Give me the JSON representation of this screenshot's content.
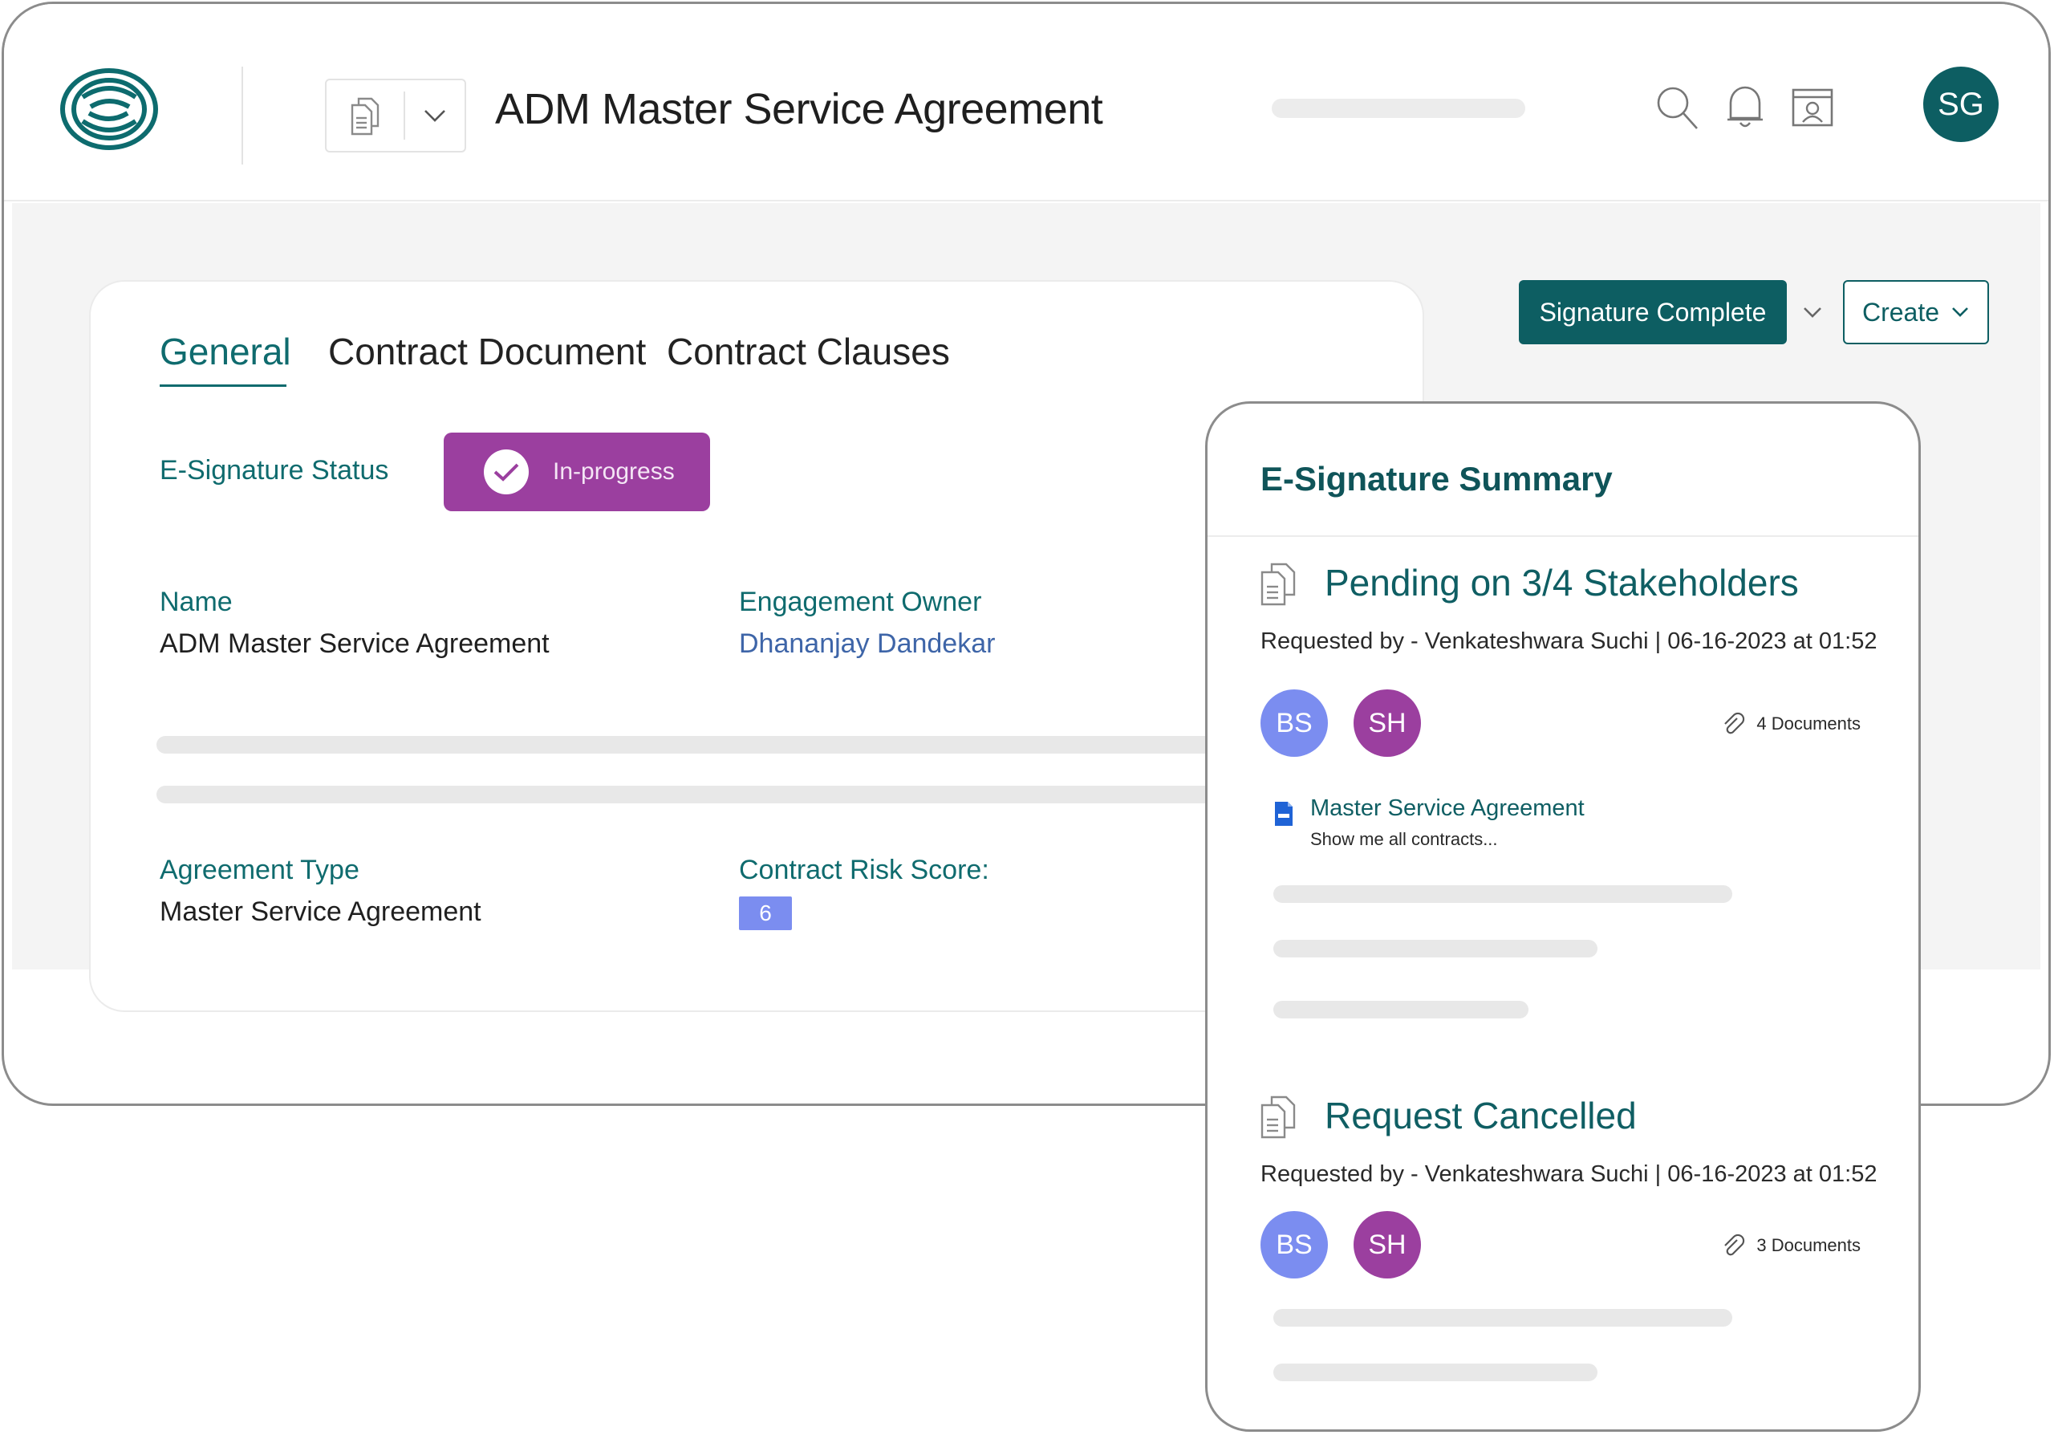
{
  "header": {
    "title": "ADM Master Service Agreement",
    "user_initials": "SG"
  },
  "tabs": [
    {
      "label": "General",
      "active": true
    },
    {
      "label": "Contract Document",
      "active": false
    },
    {
      "label": "Contract Clauses",
      "active": false
    }
  ],
  "general": {
    "esignature_label": "E-Signature Status",
    "esignature_status": "In-progress",
    "name_label": "Name",
    "name_value": "ADM Master Service Agreement",
    "owner_label": "Engagement Owner",
    "owner_value": "Dhananjay Dandekar",
    "agreement_type_label": "Agreement Type",
    "agreement_type_value": "Master Service Agreement",
    "risk_label": "Contract Risk Score:",
    "risk_value": "6"
  },
  "actions": {
    "signature_complete": "Signature Complete",
    "create": "Create"
  },
  "summary": {
    "title": "E-Signature Summary",
    "sections": [
      {
        "title": "Pending on 3/4 Stakeholders",
        "requested_by": "Requested by - Venkateshwara Suchi | 06-16-2023 at 01:52",
        "avatars": [
          "BS",
          "SH"
        ],
        "documents": "4 Documents",
        "doc_title": "Master Service Agreement",
        "doc_subtitle": "Show me all contracts..."
      },
      {
        "title": "Request Cancelled",
        "requested_by": "Requested by - Venkateshwara Suchi | 06-16-2023 at 01:52",
        "avatars": [
          "BS",
          "SH"
        ],
        "documents": "3 Documents"
      }
    ]
  },
  "colors": {
    "brand_teal": "#0d5e62",
    "status_purple": "#9b3f9f",
    "avatar_periwinkle": "#7b8df0",
    "link_blue": "#3e65a8"
  },
  "icons": {
    "logo": "brand-logo",
    "doc_switcher": "copy-document-icon",
    "search": "search-icon",
    "notifications": "bell-icon",
    "preview": "browser-user-icon",
    "attachment": "paperclip-icon",
    "doc_file": "doc-file-icon"
  }
}
